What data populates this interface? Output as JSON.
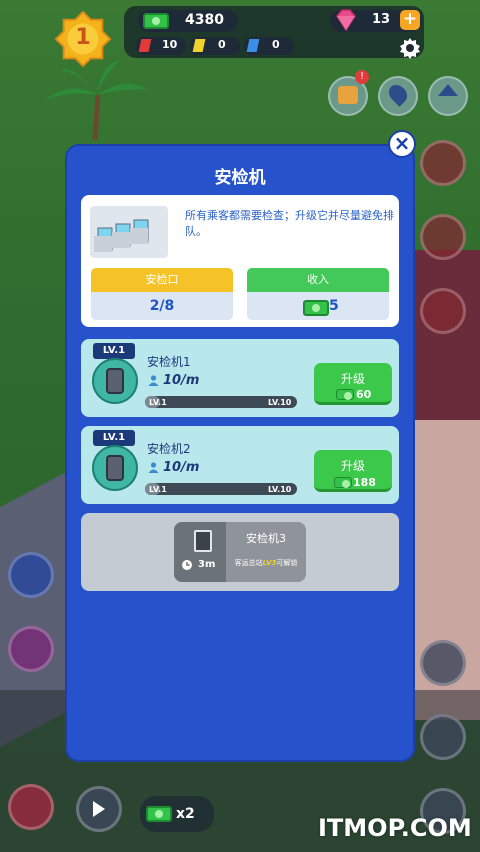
{
  "hud": {
    "level": "1",
    "money": "4380",
    "gems": "13",
    "plus": "+",
    "res_red": "10",
    "res_yellow": "0",
    "res_blue": "0"
  },
  "modal": {
    "title": "安检机",
    "close": "×",
    "description": "所有乘客都需要检查；升级它并尽量避免排队。",
    "checkpoint_label": "安检口",
    "checkpoint_value": "2/8",
    "income_label": "收入",
    "income_value": "5"
  },
  "machines": [
    {
      "lv_tag": "LV.1",
      "name": "安检机1",
      "rate": "10/m",
      "lv_start": "LV.1",
      "lv_end": "LV.10",
      "upgrade_label": "升级",
      "upgrade_cost": "60"
    },
    {
      "lv_tag": "LV.1",
      "name": "安检机2",
      "rate": "10/m",
      "lv_start": "LV.1",
      "lv_end": "LV.10",
      "upgrade_label": "升级",
      "upgrade_cost": "188"
    }
  ],
  "locked_machine": {
    "name": "安检机3",
    "time": "3m",
    "hint_prefix": "客运总站",
    "hint_level": "LV3",
    "hint_suffix": "可解锁"
  },
  "bottom": {
    "multiplier": "x2"
  },
  "watermark": "ITMOP.COM",
  "colors": {
    "modal_bg": "#2652cc",
    "upgrade_green": "#3cc84a",
    "checkpoint_yellow": "#f5c327",
    "income_green": "#43c95a"
  }
}
